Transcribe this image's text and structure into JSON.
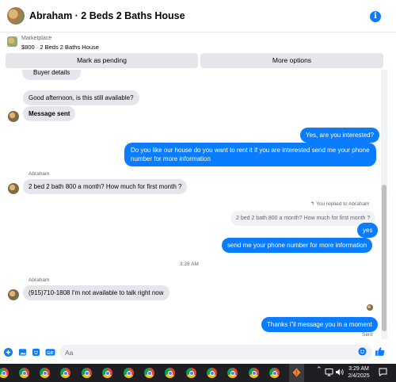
{
  "header": {
    "title": "Abraham · 2 Beds 2 Baths House"
  },
  "marketplace": {
    "label": "Marketplace",
    "item": "$800 · 2 Beds 2 Baths House"
  },
  "actions": {
    "pending": "Mark as pending",
    "more": "More options"
  },
  "thread": {
    "buyer_details": "Buyer details",
    "msg1": "Good afternoon, is this still available?",
    "msg2": "Message sent",
    "msg3": "Yes, are you interested?",
    "msg4": "Do you like our house do you want to rent it if you are interested send me your phone number for more information",
    "sender1": "Abraham",
    "msg5": "2 bed 2 bath 800 a month? How much for first month ?",
    "replied_label": "You replied to Abraham",
    "reply_quote": "2 bed 2 bath 800 a month? How much for first month ?",
    "msg6": "yes",
    "msg7": "send me your phone number for more information",
    "timestamp": "3:28 AM",
    "sender2": "Abraham",
    "msg8": "(915)710-1808 I'm not available to talk right now",
    "msg9": "Thanks i\"il message you in a moment",
    "status": "Sent"
  },
  "composer": {
    "placeholder": "Aa"
  },
  "taskbar": {
    "time": "3:29 AM",
    "date": "2/4/2025"
  },
  "colors": {
    "accent": "#0a7cff",
    "incoming": "#e4e6eb",
    "taskbar": "#1f1f23"
  },
  "icons": [
    "info-icon",
    "plus-icon",
    "photo-icon",
    "sticker-icon",
    "gif-icon",
    "emoji-icon",
    "like-icon",
    "chrome-icon",
    "chevron-up-icon",
    "network-icon",
    "volume-icon",
    "notification-icon"
  ]
}
